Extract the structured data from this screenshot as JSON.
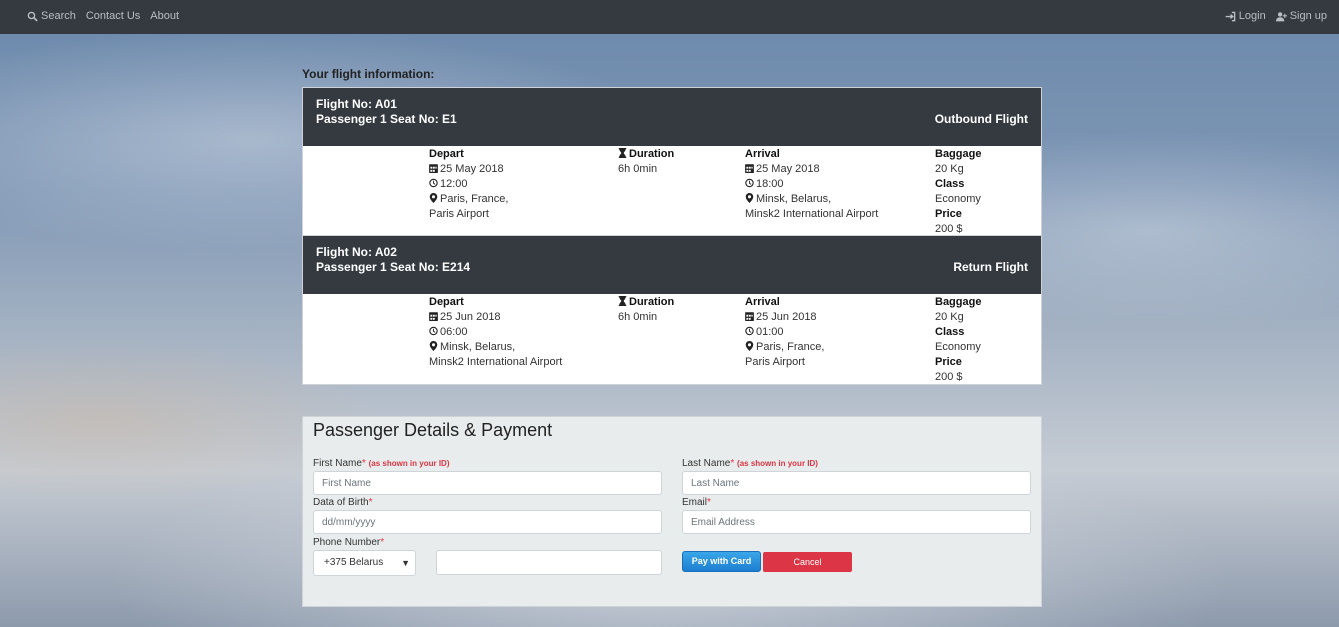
{
  "nav": {
    "search": "Search",
    "contact": "Contact Us",
    "about": "About",
    "login": "Login",
    "signup": "Sign up"
  },
  "section_title": "Your flight information:",
  "labels": {
    "depart": "Depart",
    "duration": "Duration",
    "arrival": "Arrival",
    "baggage": "Baggage",
    "class": "Class",
    "price": "Price"
  },
  "flights": [
    {
      "flight_no": "Flight No: A01",
      "seat": "Passenger 1 Seat No: E1",
      "type": "Outbound Flight",
      "depart_date": "25 May 2018",
      "depart_time": "12:00",
      "depart_city": "Paris, France,",
      "depart_airport": "Paris Airport",
      "duration": "6h 0min",
      "arrival_date": "25 May 2018",
      "arrival_time": "18:00",
      "arrival_city": "Minsk, Belarus,",
      "arrival_airport": "Minsk2 International Airport",
      "baggage": "20 Kg",
      "class": "Economy",
      "price": "200 $"
    },
    {
      "flight_no": "Flight No: A02",
      "seat": "Passenger 1 Seat No: E214",
      "type": "Return Flight",
      "depart_date": "25 Jun 2018",
      "depart_time": "06:00",
      "depart_city": "Minsk, Belarus,",
      "depart_airport": "Minsk2 International Airport",
      "duration": "6h 0min",
      "arrival_date": "25 Jun 2018",
      "arrival_time": "01:00",
      "arrival_city": "Paris, France,",
      "arrival_airport": "Paris Airport",
      "baggage": "20 Kg",
      "class": "Economy",
      "price": "200 $"
    }
  ],
  "form": {
    "title": "Passenger Details & Payment",
    "first_name_label": "First Name",
    "last_name_label": "Last Name",
    "id_note": "(as shown in your ID)",
    "req_mark": "*",
    "first_name_placeholder": "First Name",
    "last_name_placeholder": "Last Name",
    "dob_label": "Data of Birth",
    "dob_placeholder": "dd/mm/yyyy",
    "email_label": "Email",
    "email_placeholder": "Email Address",
    "phone_label": "Phone Number",
    "phone_code": "+375 Belarus",
    "phone_value": "",
    "pay_button": "Pay with Card",
    "cancel_button": "Cancel"
  }
}
